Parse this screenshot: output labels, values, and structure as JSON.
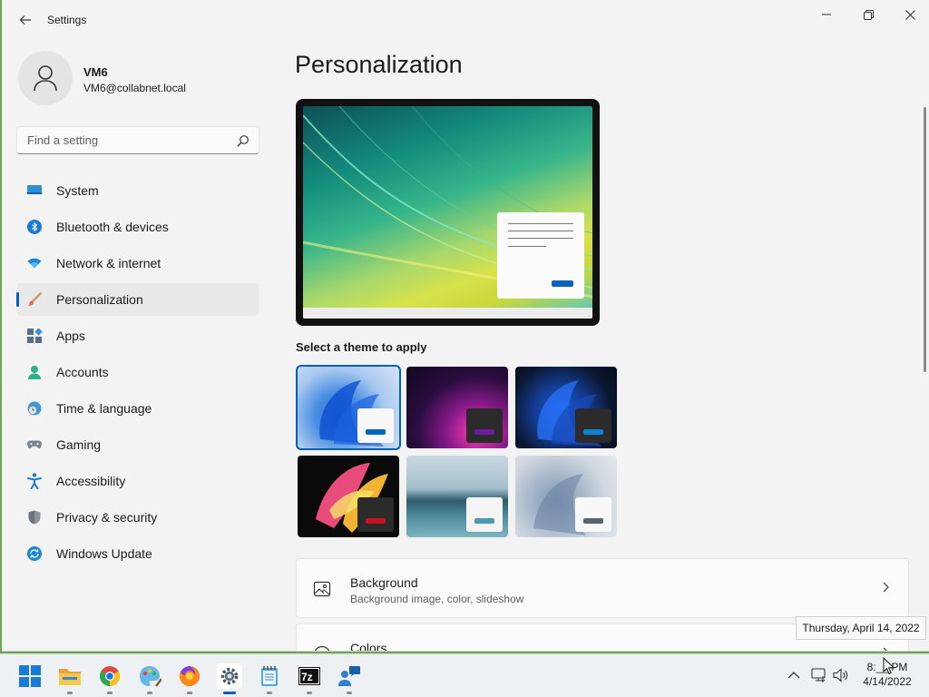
{
  "window": {
    "title": "Settings",
    "back_icon": "arrow-left-icon",
    "controls": [
      "minimize-icon",
      "restore-icon",
      "close-icon"
    ]
  },
  "profile": {
    "name": "VM6",
    "email": "VM6@collabnet.local"
  },
  "search": {
    "placeholder": "Find a setting",
    "value": ""
  },
  "nav": {
    "items": [
      {
        "label": "System",
        "icon": "system-display-icon",
        "active": false
      },
      {
        "label": "Bluetooth & devices",
        "icon": "bluetooth-icon",
        "active": false
      },
      {
        "label": "Network & internet",
        "icon": "wifi-icon",
        "active": false
      },
      {
        "label": "Personalization",
        "icon": "paintbrush-icon",
        "active": true
      },
      {
        "label": "Apps",
        "icon": "apps-icon",
        "active": false
      },
      {
        "label": "Accounts",
        "icon": "person-icon",
        "active": false
      },
      {
        "label": "Time & language",
        "icon": "globe-clock-icon",
        "active": false
      },
      {
        "label": "Gaming",
        "icon": "gamepad-icon",
        "active": false
      },
      {
        "label": "Accessibility",
        "icon": "accessibility-icon",
        "active": false
      },
      {
        "label": "Privacy & security",
        "icon": "shield-icon",
        "active": false
      },
      {
        "label": "Windows Update",
        "icon": "update-icon",
        "active": false
      }
    ]
  },
  "main": {
    "title": "Personalization",
    "theme_heading": "Select a theme to apply",
    "themes": [
      {
        "name": "windows-light-theme",
        "accent": "#0067c0",
        "selected": true
      },
      {
        "name": "glow-theme",
        "accent": "#6b1c9c",
        "selected": false
      },
      {
        "name": "windows-dark-theme",
        "accent": "#0a84d6",
        "selected": false
      },
      {
        "name": "captured-motion-theme",
        "accent": "#c3141d",
        "selected": false
      },
      {
        "name": "flow-theme",
        "accent": "#4a9bb0",
        "selected": false
      },
      {
        "name": "sunrise-theme",
        "accent": "#5b6270",
        "selected": false
      }
    ],
    "rows": [
      {
        "title": "Background",
        "subtitle": "Background image, color, slideshow",
        "icon": "image-icon"
      },
      {
        "title": "Colors",
        "subtitle": "",
        "icon": "palette-icon"
      }
    ]
  },
  "taskbar": {
    "apps": [
      "start-icon",
      "file-explorer-icon",
      "chrome-icon",
      "paint-icon",
      "firefox-icon",
      "settings-icon",
      "notepad-icon",
      "7zip-icon",
      "remote-assist-icon"
    ],
    "tray": [
      "chevron-up-icon",
      "network-icon",
      "volume-icon"
    ],
    "time": "8:__ PM",
    "date": "4/14/2022"
  },
  "tooltip": {
    "text": "Thursday, April 14, 2022"
  },
  "colors": {
    "accent": "#005fb8",
    "window_bg": "#f3f3f3"
  }
}
